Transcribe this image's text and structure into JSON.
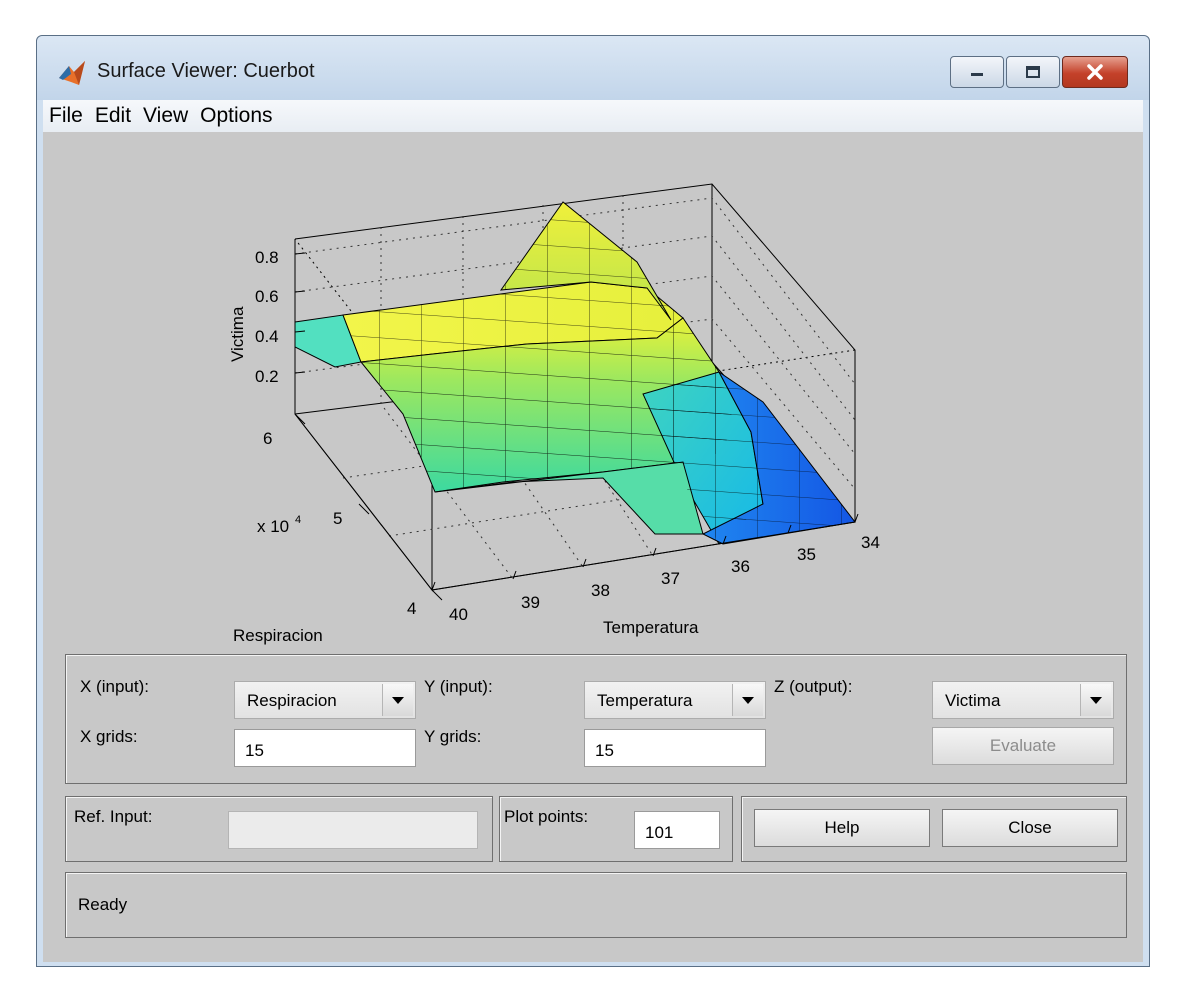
{
  "window": {
    "title": "Surface Viewer: Cuerbot"
  },
  "menu": [
    "File",
    "Edit",
    "View",
    "Options"
  ],
  "plot": {
    "zlabel": "Victima",
    "ylabel": "Respiracion",
    "xlabel": "Temperatura",
    "exponent": "x 10",
    "exponent_power": "4",
    "z_ticks": [
      "0.8",
      "0.6",
      "0.4",
      "0.2"
    ],
    "resp_ticks": [
      "6",
      "5",
      "4"
    ],
    "temp_ticks": [
      "40",
      "39",
      "38",
      "37",
      "36",
      "35",
      "34"
    ]
  },
  "controls": {
    "x_input_label": "X (input):",
    "x_input_value": "Respiracion",
    "y_input_label": "Y (input):",
    "y_input_value": "Temperatura",
    "z_output_label": "Z (output):",
    "z_output_value": "Victima",
    "x_grids_label": "X grids:",
    "x_grids_value": "15",
    "y_grids_label": "Y grids:",
    "y_grids_value": "15",
    "evaluate_label": "Evaluate",
    "ref_input_label": "Ref. Input:",
    "ref_input_value": "",
    "plot_points_label": "Plot points:",
    "plot_points_value": "101",
    "help_label": "Help",
    "close_label": "Close"
  },
  "status": {
    "text": "Ready"
  },
  "colors": {
    "titlebar": "#c9d9ec",
    "client": "#c8c8c8",
    "close_button": "#c4412a"
  }
}
